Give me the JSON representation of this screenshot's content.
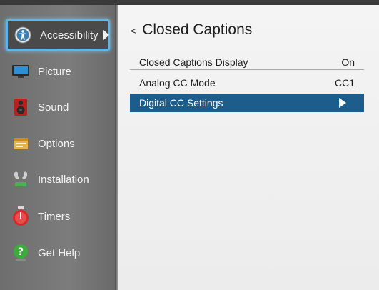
{
  "sidebar": {
    "items": [
      {
        "label": "Accessibility",
        "icon": "accessibility-icon",
        "active": true
      },
      {
        "label": "Picture",
        "icon": "picture-icon"
      },
      {
        "label": "Sound",
        "icon": "speaker-icon"
      },
      {
        "label": "Options",
        "icon": "options-icon"
      },
      {
        "label": "Installation",
        "icon": "installation-icon"
      },
      {
        "label": "Timers",
        "icon": "timer-icon"
      },
      {
        "label": "Get Help",
        "icon": "help-icon"
      }
    ]
  },
  "main": {
    "back_symbol": "<",
    "title": "Closed Captions",
    "rows": [
      {
        "label": "Closed Captions Display",
        "value": "On"
      },
      {
        "label": "Analog CC Mode",
        "value": "CC1"
      },
      {
        "label": "Digital CC Settings",
        "value": ""
      }
    ]
  },
  "colors": {
    "accent": "#1c5d8c",
    "focus_border": "#5fb6e6",
    "sidebar": "#767676"
  }
}
